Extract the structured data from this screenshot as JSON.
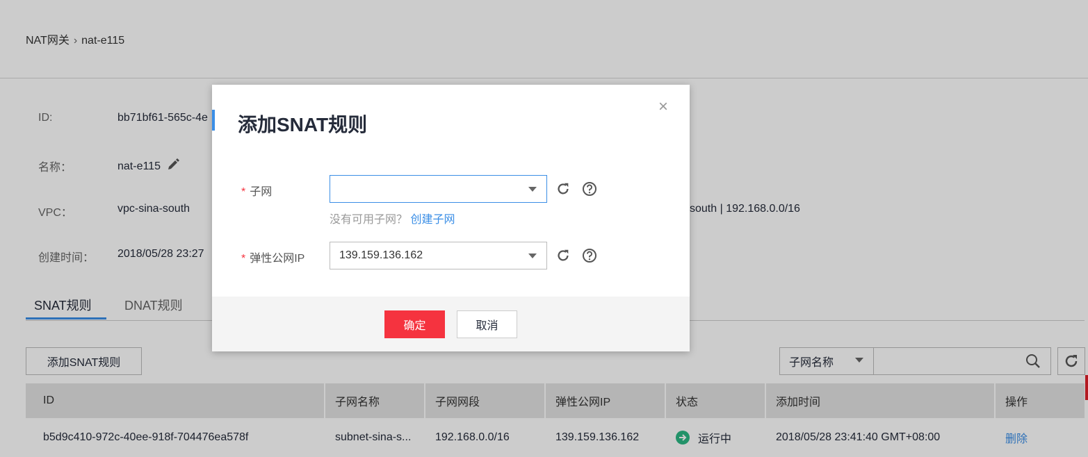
{
  "breadcrumb": {
    "parent": "NAT网关",
    "separator": "›",
    "current": "nat-e115"
  },
  "info": [
    {
      "label": "ID:",
      "value": "bb71bf61-565c-4e"
    },
    {
      "label": "名称：",
      "value": "nat-e115"
    },
    {
      "label": "VPC：",
      "value": "vpc-sina-south",
      "value_right": "south | 192.168.0.0/16"
    },
    {
      "label": "创建时间：",
      "value": "2018/05/28 23:27"
    }
  ],
  "tabs": [
    {
      "label": "SNAT规则",
      "active": true
    },
    {
      "label": "DNAT规则",
      "active": false
    }
  ],
  "toolbar": {
    "add_label": "添加SNAT规则",
    "filter_field": "子网名称",
    "search_value": ""
  },
  "table": {
    "headers": [
      "ID",
      "子网名称",
      "子网网段",
      "弹性公网IP",
      "状态",
      "添加时间",
      "操作"
    ],
    "rows": [
      {
        "id": "b5d9c410-972c-40ee-918f-704476ea578f",
        "subnet_name": "subnet-sina-s...",
        "cidr": "192.168.0.0/16",
        "eip": "139.159.136.162",
        "status": "运行中",
        "added": "2018/05/28 23:41:40 GMT+08:00",
        "action": "删除"
      }
    ]
  },
  "modal": {
    "title": "添加SNAT规则",
    "close": "×",
    "fields": [
      {
        "label": "子网",
        "required": "*",
        "value": ""
      },
      {
        "label": "弹性公网IP",
        "required": "*",
        "value": "139.159.136.162"
      }
    ],
    "hint": "没有可用子网？",
    "hint_link": "创建子网",
    "confirm": "确定",
    "cancel": "取消"
  },
  "colors": {
    "accent": "#3a8ee6",
    "danger": "#f5333f",
    "status_running": "#2bb784"
  }
}
